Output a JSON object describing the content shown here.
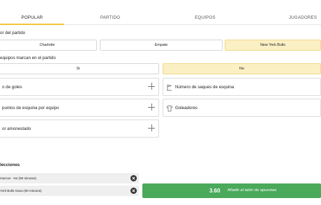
{
  "tabs": [
    "POPULAR",
    "PARTIDO",
    "EQUIPOS",
    "JUGADORES"
  ],
  "active_tab": "POPULAR",
  "match_result": {
    "label": "or del partido",
    "options": [
      "Charlotte",
      "Empate",
      "New York Bulls"
    ],
    "selected": "New York Bulls"
  },
  "both_score": {
    "label": "equipos marcan en el partido",
    "options": [
      "Sí",
      "No"
    ],
    "selected": "No"
  },
  "markets": [
    {
      "label": "o de goles",
      "icon": "plus-icon"
    },
    {
      "label": "Número de saques de esquina",
      "icon": "corner-flag-icon"
    },
    {
      "label": "puntos de esquina por equipo",
      "icon": "plus-icon"
    },
    {
      "label": "Goleadores",
      "icon": "shirt-icon"
    },
    {
      "label": "or amonestado",
      "icon": "plus-icon"
    }
  ],
  "selections": {
    "title": "lecciones",
    "items": [
      "marcan - No (90 minutos)",
      "York Bulls Gana (90 minutos)"
    ]
  },
  "betslip": {
    "odds": "3.60",
    "label": "Añadir al talón de apuestas"
  },
  "colors": {
    "accent": "#f2c53a",
    "selected_bg": "#fbefc4",
    "betslip_green": "#4aa95a"
  }
}
